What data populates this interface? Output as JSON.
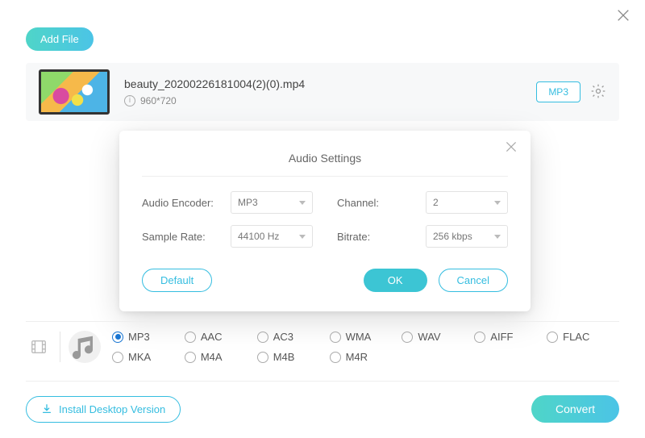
{
  "header": {
    "add_file": "Add File"
  },
  "file": {
    "name": "beauty_20200226181004(2)(0).mp4",
    "resolution": "960*720",
    "output_format": "MP3"
  },
  "modal": {
    "title": "Audio Settings",
    "labels": {
      "encoder": "Audio Encoder:",
      "sample_rate": "Sample Rate:",
      "channel": "Channel:",
      "bitrate": "Bitrate:"
    },
    "values": {
      "encoder": "MP3",
      "sample_rate": "44100 Hz",
      "channel": "2",
      "bitrate": "256 kbps"
    },
    "buttons": {
      "default": "Default",
      "ok": "OK",
      "cancel": "Cancel"
    }
  },
  "formats": {
    "items": [
      "MP3",
      "AAC",
      "AC3",
      "WMA",
      "WAV",
      "AIFF",
      "FLAC",
      "MKA",
      "M4A",
      "M4B",
      "M4R"
    ],
    "selected": "MP3"
  },
  "bottom": {
    "install": "Install Desktop Version",
    "convert": "Convert"
  }
}
